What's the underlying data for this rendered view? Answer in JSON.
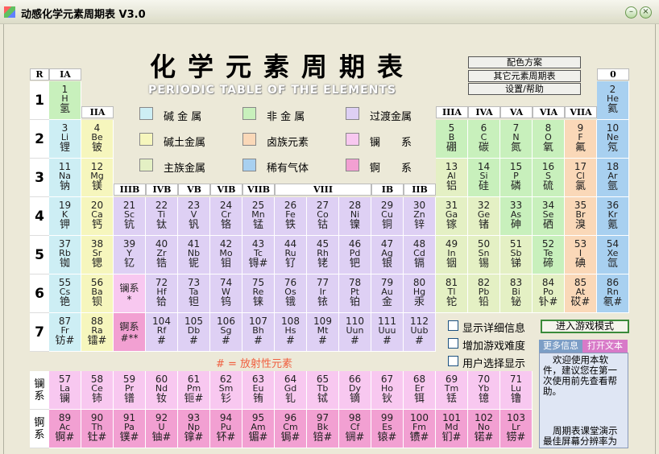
{
  "window": {
    "title": "动感化学元素周期表 V3.0",
    "minimize_icon": "minimize-icon",
    "close_icon": "close-icon"
  },
  "heading": {
    "title": "化学元素周期表",
    "subtitle": "PERIODIC TABLE OF THE ELEMENTS"
  },
  "menu_buttons": [
    "配色方案",
    "其它元素周期表",
    "设置/帮助"
  ],
  "group_headers": {
    "R": "R",
    "IA": "IA",
    "IIA": "IIA",
    "IIIA": "IIIA",
    "IVA": "IVA",
    "VA": "VA",
    "VIA": "VIA",
    "VIIA": "VIIA",
    "0": "0",
    "IIIB": "IIIB",
    "IVB": "IVB",
    "VB": "VB",
    "VIB": "VIB",
    "VIIB": "VIIB",
    "VIII": "VIII",
    "IB": "IB",
    "IIB": "IIB"
  },
  "periods": [
    "1",
    "2",
    "3",
    "4",
    "5",
    "6",
    "7"
  ],
  "legend": [
    {
      "label": "碱 金 属",
      "color": "#cdeef4"
    },
    {
      "label": "非 金 属",
      "color": "#c8f0bc"
    },
    {
      "label": "过渡金属",
      "color": "#ded0f4"
    },
    {
      "label": "碱土金属",
      "color": "#f6f6bd"
    },
    {
      "label": "卤族元素",
      "color": "#fad8b8"
    },
    {
      "label": "镧　　系",
      "color": "#f8c8f0"
    },
    {
      "label": "主族金属",
      "color": "#e4f0c4"
    },
    {
      "label": "稀有气体",
      "color": "#a8d0f0"
    },
    {
      "label": "锕　　系",
      "color": "#f2a0d2"
    }
  ],
  "elements": [
    [
      "1",
      "H",
      "氢",
      "nm",
      1,
      1
    ],
    [
      "2",
      "He",
      "氦",
      "ng",
      18,
      1
    ],
    [
      "3",
      "Li",
      "锂",
      "alk",
      1,
      2
    ],
    [
      "4",
      "Be",
      "铍",
      "ea",
      2,
      2
    ],
    [
      "5",
      "B",
      "硼",
      "nm",
      13,
      2
    ],
    [
      "6",
      "C",
      "碳",
      "nm",
      14,
      2
    ],
    [
      "7",
      "N",
      "氮",
      "nm",
      15,
      2
    ],
    [
      "8",
      "O",
      "氧",
      "nm",
      16,
      2
    ],
    [
      "9",
      "F",
      "氟",
      "hal",
      17,
      2
    ],
    [
      "10",
      "Ne",
      "氖",
      "ng",
      18,
      2
    ],
    [
      "11",
      "Na",
      "钠",
      "alk",
      1,
      3
    ],
    [
      "12",
      "Mg",
      "镁",
      "ea",
      2,
      3
    ],
    [
      "13",
      "Al",
      "铝",
      "mg",
      13,
      3
    ],
    [
      "14",
      "Si",
      "硅",
      "nm",
      14,
      3
    ],
    [
      "15",
      "P",
      "磷",
      "nm",
      15,
      3
    ],
    [
      "16",
      "S",
      "硫",
      "nm",
      16,
      3
    ],
    [
      "17",
      "Cl",
      "氯",
      "hal",
      17,
      3
    ],
    [
      "18",
      "Ar",
      "氩",
      "ng",
      18,
      3
    ],
    [
      "19",
      "K",
      "钾",
      "alk",
      1,
      4
    ],
    [
      "20",
      "Ca",
      "钙",
      "ea",
      2,
      4
    ],
    [
      "21",
      "Sc",
      "钪",
      "trn",
      3,
      4
    ],
    [
      "22",
      "Ti",
      "钛",
      "trn",
      4,
      4
    ],
    [
      "23",
      "V",
      "钒",
      "trn",
      5,
      4
    ],
    [
      "24",
      "Cr",
      "铬",
      "trn",
      6,
      4
    ],
    [
      "25",
      "Mn",
      "锰",
      "trn",
      7,
      4
    ],
    [
      "26",
      "Fe",
      "铁",
      "trn",
      8,
      4
    ],
    [
      "27",
      "Co",
      "钴",
      "trn",
      9,
      4
    ],
    [
      "28",
      "Ni",
      "镍",
      "trn",
      10,
      4
    ],
    [
      "29",
      "Cu",
      "铜",
      "trn",
      11,
      4
    ],
    [
      "30",
      "Zn",
      "锌",
      "trn",
      12,
      4
    ],
    [
      "31",
      "Ga",
      "镓",
      "mg",
      13,
      4
    ],
    [
      "32",
      "Ge",
      "锗",
      "mg",
      14,
      4
    ],
    [
      "33",
      "As",
      "砷",
      "nm",
      15,
      4
    ],
    [
      "34",
      "Se",
      "硒",
      "nm",
      16,
      4
    ],
    [
      "35",
      "Br",
      "溴",
      "hal",
      17,
      4
    ],
    [
      "36",
      "Kr",
      "氪",
      "ng",
      18,
      4
    ],
    [
      "37",
      "Rb",
      "铷",
      "alk",
      1,
      5
    ],
    [
      "38",
      "Sr",
      "锶",
      "ea",
      2,
      5
    ],
    [
      "39",
      "Y",
      "钇",
      "trn",
      3,
      5
    ],
    [
      "40",
      "Zr",
      "锆",
      "trn",
      4,
      5
    ],
    [
      "41",
      "Nb",
      "铌",
      "trn",
      5,
      5
    ],
    [
      "42",
      "Mo",
      "钼",
      "trn",
      6,
      5
    ],
    [
      "43",
      "Tc",
      "锝#",
      "trn",
      7,
      5
    ],
    [
      "44",
      "Ru",
      "钌",
      "trn",
      8,
      5
    ],
    [
      "45",
      "Rh",
      "铑",
      "trn",
      9,
      5
    ],
    [
      "46",
      "Pd",
      "钯",
      "trn",
      10,
      5
    ],
    [
      "47",
      "Ag",
      "银",
      "trn",
      11,
      5
    ],
    [
      "48",
      "Cd",
      "镉",
      "trn",
      12,
      5
    ],
    [
      "49",
      "In",
      "铟",
      "mg",
      13,
      5
    ],
    [
      "50",
      "Sn",
      "锡",
      "mg",
      14,
      5
    ],
    [
      "51",
      "Sb",
      "锑",
      "mg",
      15,
      5
    ],
    [
      "52",
      "Te",
      "碲",
      "nm",
      16,
      5
    ],
    [
      "53",
      "I",
      "碘",
      "hal",
      17,
      5
    ],
    [
      "54",
      "Xe",
      "氙",
      "ng",
      18,
      5
    ],
    [
      "55",
      "Cs",
      "铯",
      "alk",
      1,
      6
    ],
    [
      "56",
      "Ba",
      "钡",
      "ea",
      2,
      6
    ],
    [
      "72",
      "Hf",
      "铪",
      "trn",
      4,
      6
    ],
    [
      "73",
      "Ta",
      "钽",
      "trn",
      5,
      6
    ],
    [
      "74",
      "W",
      "钨",
      "trn",
      6,
      6
    ],
    [
      "75",
      "Re",
      "铼",
      "trn",
      7,
      6
    ],
    [
      "76",
      "Os",
      "锇",
      "trn",
      8,
      6
    ],
    [
      "77",
      "Ir",
      "铱",
      "trn",
      9,
      6
    ],
    [
      "78",
      "Pt",
      "铂",
      "trn",
      10,
      6
    ],
    [
      "79",
      "Au",
      "金",
      "trn",
      11,
      6
    ],
    [
      "80",
      "Hg",
      "汞",
      "trn",
      12,
      6
    ],
    [
      "81",
      "Tl",
      "铊",
      "mg",
      13,
      6
    ],
    [
      "82",
      "Pb",
      "铅",
      "mg",
      14,
      6
    ],
    [
      "83",
      "Bi",
      "铋",
      "mg",
      15,
      6
    ],
    [
      "84",
      "Po",
      "钋#",
      "mg",
      16,
      6
    ],
    [
      "85",
      "At",
      "砹#",
      "hal",
      17,
      6
    ],
    [
      "86",
      "Rn",
      "氡#",
      "ng",
      18,
      6
    ],
    [
      "87",
      "Fr",
      "钫#",
      "alk",
      1,
      7
    ],
    [
      "88",
      "Ra",
      "镭#",
      "ea",
      2,
      7
    ],
    [
      "104",
      "Rf",
      "#",
      "trn",
      4,
      7
    ],
    [
      "105",
      "Db",
      "#",
      "trn",
      5,
      7
    ],
    [
      "106",
      "Sg",
      "#",
      "trn",
      6,
      7
    ],
    [
      "107",
      "Bh",
      "#",
      "trn",
      7,
      7
    ],
    [
      "108",
      "Hs",
      "#",
      "trn",
      8,
      7
    ],
    [
      "109",
      "Mt",
      "#",
      "trn",
      9,
      7
    ],
    [
      "110",
      "Uun",
      "#",
      "trn",
      10,
      7
    ],
    [
      "111",
      "Uuu",
      "#",
      "trn",
      11,
      7
    ],
    [
      "112",
      "Uub",
      "#",
      "trn",
      12,
      7
    ]
  ],
  "series_placeholders": [
    {
      "l1": "镧系",
      "l2": "*",
      "cls": "lan",
      "col": 3,
      "row": 6
    },
    {
      "l1": "锕系",
      "l2": "#**",
      "cls": "act",
      "col": 3,
      "row": 7
    }
  ],
  "radio_note": "# = 放射性元素",
  "lanthanides": [
    [
      "57",
      "La",
      "镧"
    ],
    [
      "58",
      "Ce",
      "铈"
    ],
    [
      "59",
      "Pr",
      "镨"
    ],
    [
      "60",
      "Nd",
      "钕"
    ],
    [
      "61",
      "Pm",
      "钷#"
    ],
    [
      "62",
      "Sm",
      "钐"
    ],
    [
      "63",
      "Eu",
      "铕"
    ],
    [
      "64",
      "Gd",
      "钆"
    ],
    [
      "65",
      "Tb",
      "铽"
    ],
    [
      "66",
      "Dy",
      "镝"
    ],
    [
      "67",
      "Ho",
      "钬"
    ],
    [
      "68",
      "Er",
      "铒"
    ],
    [
      "69",
      "Tm",
      "铥"
    ],
    [
      "70",
      "Yb",
      "镱"
    ],
    [
      "71",
      "Lu",
      "镥"
    ]
  ],
  "actinides": [
    [
      "89",
      "Ac",
      "锕#"
    ],
    [
      "90",
      "Th",
      "钍#"
    ],
    [
      "91",
      "Pa",
      "镤#"
    ],
    [
      "92",
      "U",
      "铀#"
    ],
    [
      "93",
      "Np",
      "镎#"
    ],
    [
      "94",
      "Pu",
      "钚#"
    ],
    [
      "95",
      "Am",
      "镅#"
    ],
    [
      "96",
      "Cm",
      "锔#"
    ],
    [
      "97",
      "Bk",
      "锫#"
    ],
    [
      "98",
      "Cf",
      "锎#"
    ],
    [
      "99",
      "Es",
      "锿#"
    ],
    [
      "100",
      "Fm",
      "镄#"
    ],
    [
      "101",
      "Md",
      "钔#"
    ],
    [
      "102",
      "No",
      "锘#"
    ],
    [
      "103",
      "Lr",
      "铹#"
    ]
  ],
  "series_labels": {
    "lan": "镧系",
    "act": "锕系"
  },
  "options": [
    "显示详细信息",
    "增加游戏难度",
    "用户选择显示"
  ],
  "game_button": "进入游戏模式",
  "tabs": {
    "more": "更多信息",
    "open": "打开文本"
  },
  "info": {
    "p1": "欢迎使用本软件，建议您在第一次使用前先查看帮助。",
    "p2": "周期表课堂演示最佳屏幕分辨率为800X600"
  }
}
